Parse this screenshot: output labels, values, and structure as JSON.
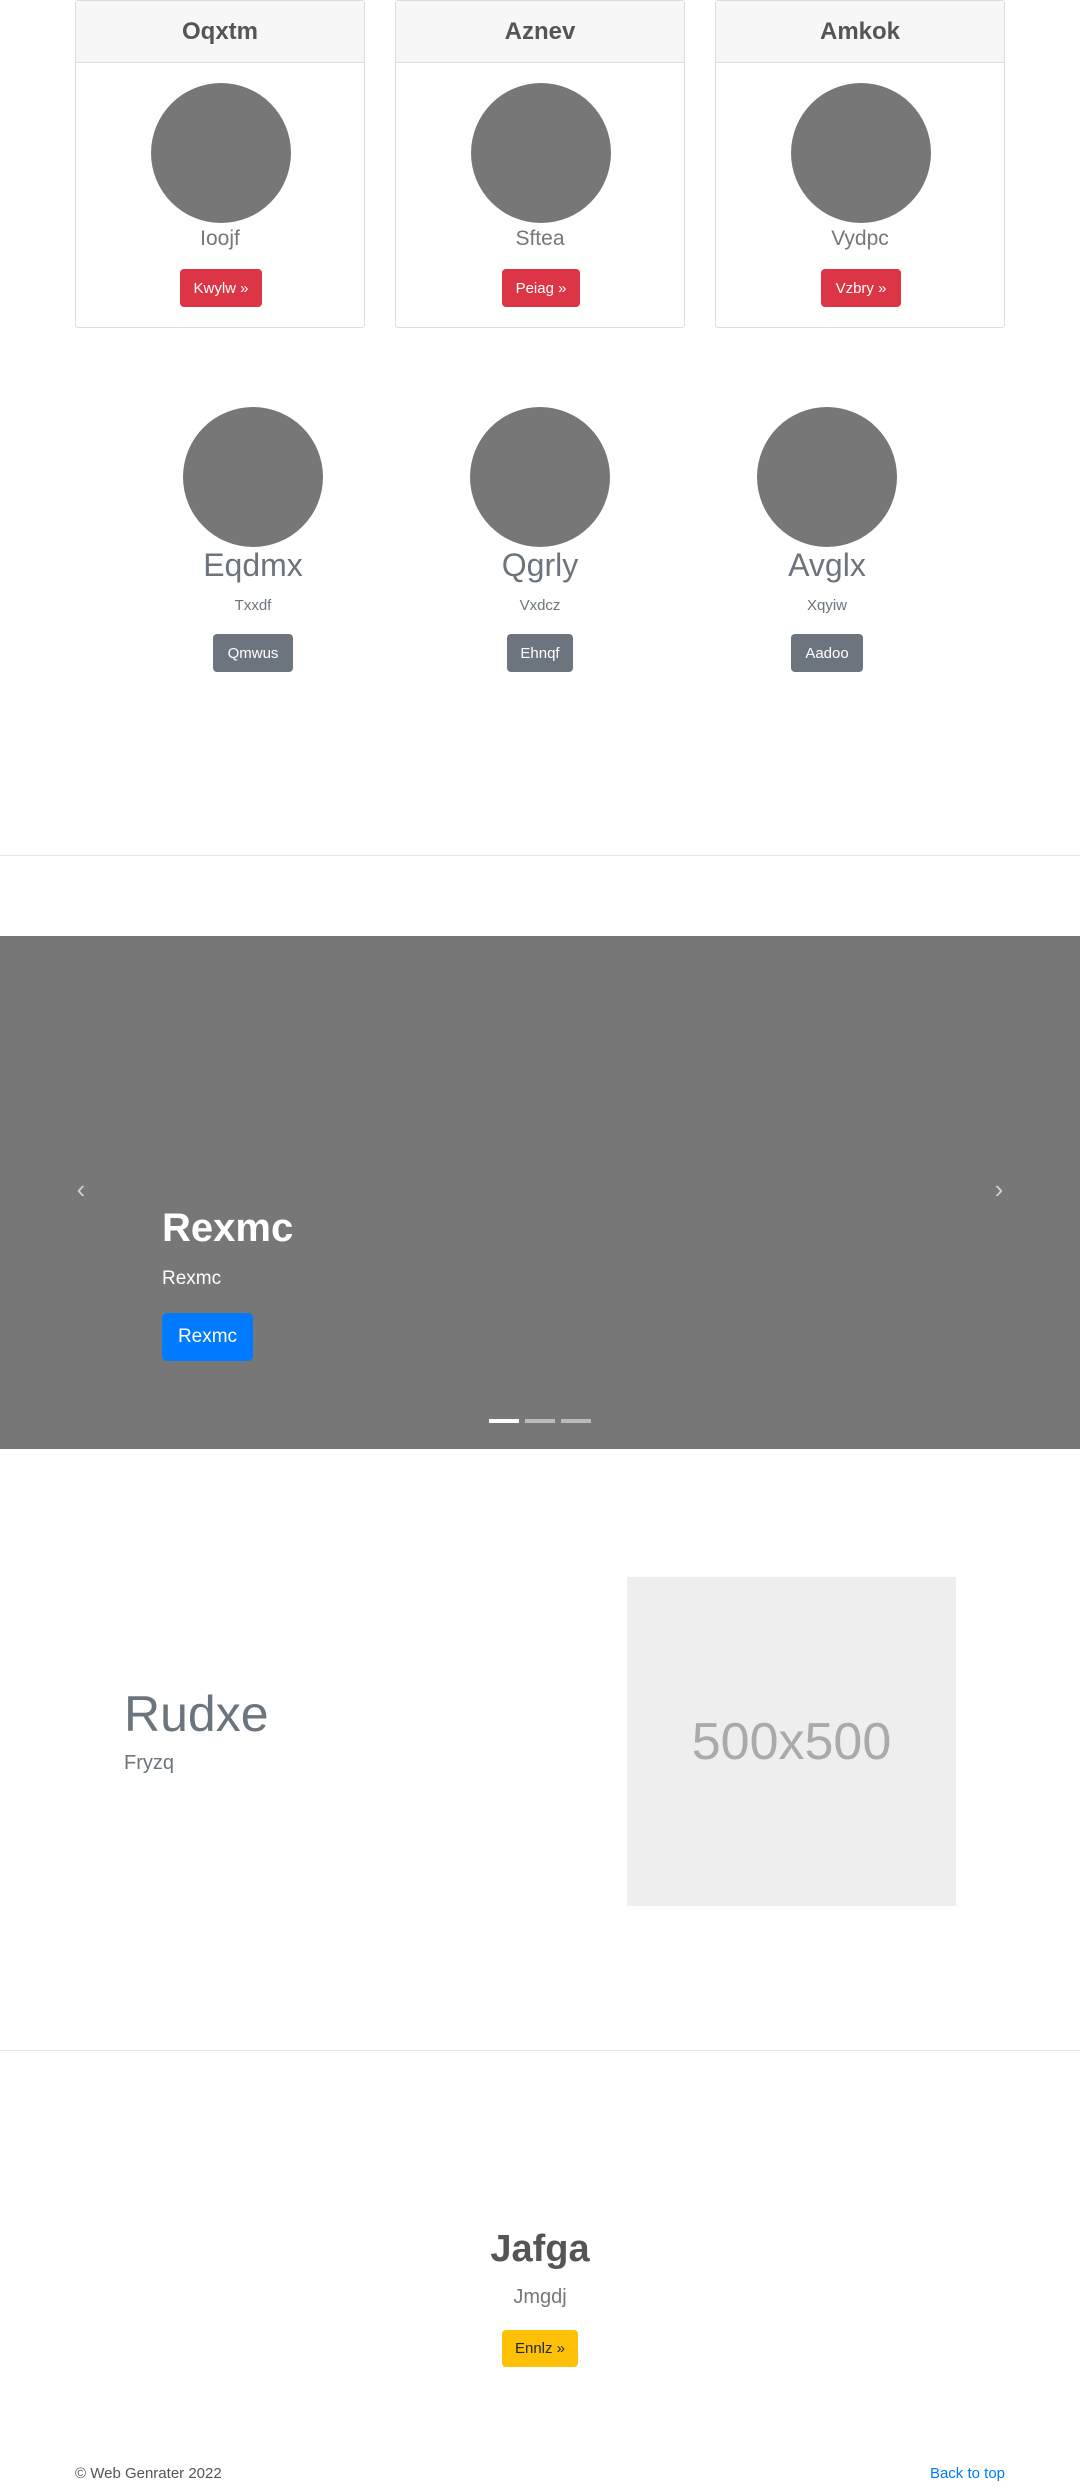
{
  "cards": [
    {
      "title": "Oqxtm",
      "text": "Ioojf",
      "button": "Kwylw »"
    },
    {
      "title": "Aznev",
      "text": "Sftea",
      "button": "Peiag »"
    },
    {
      "title": "Amkok",
      "text": "Vydpc",
      "button": "Vzbry »"
    }
  ],
  "team": [
    {
      "name": "Eqdmx",
      "role": "Txxdf",
      "button": "Qmwus"
    },
    {
      "name": "Qgrly",
      "role": "Vxdcz",
      "button": "Ehnqf"
    },
    {
      "name": "Avglx",
      "role": "Xqyiw",
      "button": "Aadoo"
    }
  ],
  "carousel": {
    "title": "Rexmc",
    "text": "Rexmc",
    "button": "Rexmc",
    "prev_icon": "‹",
    "next_icon": "›",
    "slide_count": 3,
    "active_slide": 1
  },
  "feature": {
    "title": "Rudxe",
    "subtitle": "Fryzq",
    "placeholder": "500x500"
  },
  "jumbotron": {
    "title": "Jafga",
    "subtitle": "Jmgdj",
    "button": "Ennlz »"
  },
  "footer": {
    "copyright": "© Web Genrater 2022",
    "back_to_top": "Back to top"
  },
  "colors": {
    "danger": "#dc3545",
    "secondary": "#6c757d",
    "primary": "#007bff",
    "warning": "#ffc107",
    "placeholder_gray": "#777777"
  }
}
